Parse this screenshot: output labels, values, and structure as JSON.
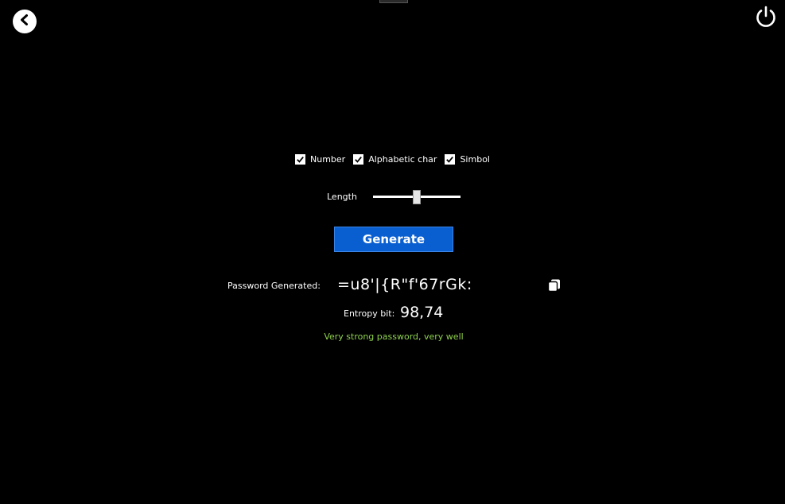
{
  "window": {
    "back_icon": "chevron-left-icon",
    "power_icon": "power-icon"
  },
  "options": {
    "items": [
      {
        "label": "Number",
        "checked": true
      },
      {
        "label": "Alphabetic char",
        "checked": true
      },
      {
        "label": "Simbol",
        "checked": true
      }
    ]
  },
  "length": {
    "label": "Length",
    "value_fraction": 0.5
  },
  "generate": {
    "label": "Generate"
  },
  "result": {
    "password_label": "Password Generated:",
    "password": "=u8'|{R\"f'67rGk:",
    "copy_icon": "copy-icon",
    "entropy_label": "Entropy bit:",
    "entropy_value": "98,74",
    "strength_message": "Very strong password, very well",
    "strength_color": "#8fd14f"
  },
  "colors": {
    "background": "#000000",
    "accent": "#0a5fd0"
  }
}
